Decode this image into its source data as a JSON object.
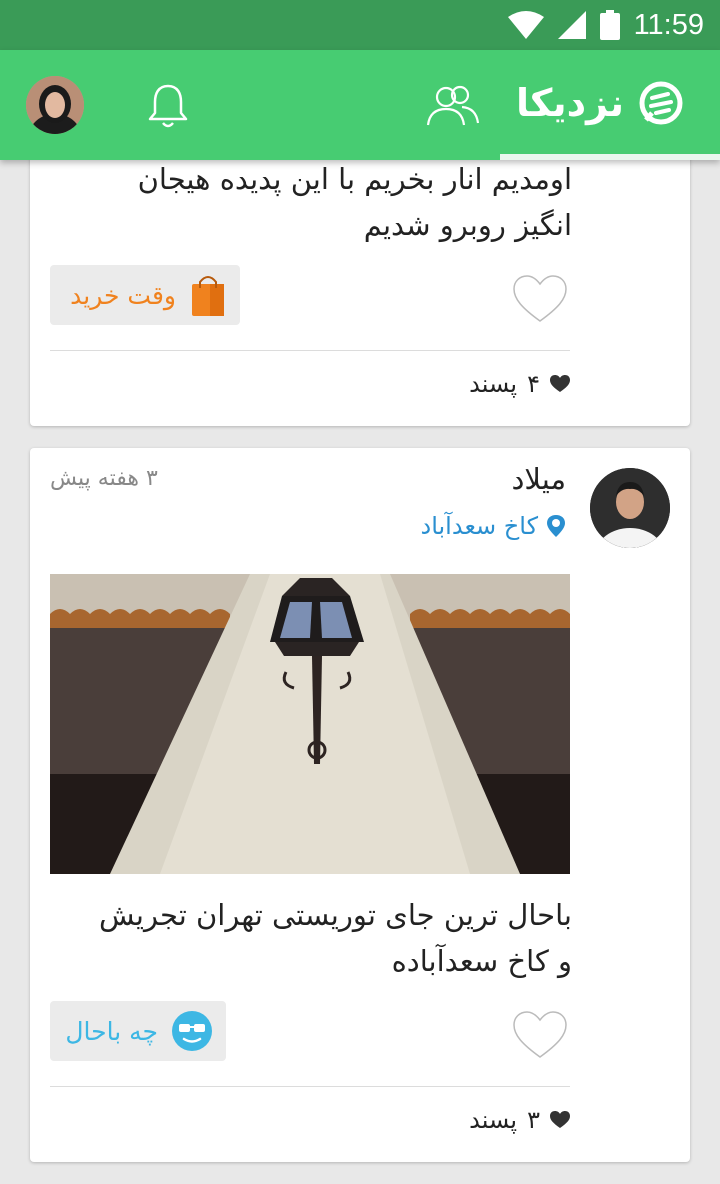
{
  "status_bar": {
    "time": "11:59"
  },
  "app_bar": {
    "title": "نزدیکا"
  },
  "posts": [
    {
      "text_lines": [
        "اومدیم انار بخریم با این پدیده هیجان",
        "انگیز روبرو شدیم"
      ],
      "reaction": {
        "label": "وقت خرید",
        "icon": "shopping-bag-icon",
        "color": "#f0821e"
      },
      "likes_count": "۴",
      "likes_label": "پسند"
    },
    {
      "author": "میلاد",
      "time_ago": "۳ هفته پیش",
      "location": "کاخ سعدآباد",
      "image_alt": "lamp-photo",
      "text_lines": [
        "باحال ترین جای توریستی تهران تجریش",
        "و کاخ سعدآباده"
      ],
      "reaction": {
        "label": "چه باحال",
        "icon": "cool-face-icon",
        "color": "#3db7e4"
      },
      "likes_count": "۳",
      "likes_label": "پسند"
    }
  ],
  "colors": {
    "primary": "#47cc72",
    "status_bar": "#3a9b57",
    "location": "#2a8fd0"
  }
}
